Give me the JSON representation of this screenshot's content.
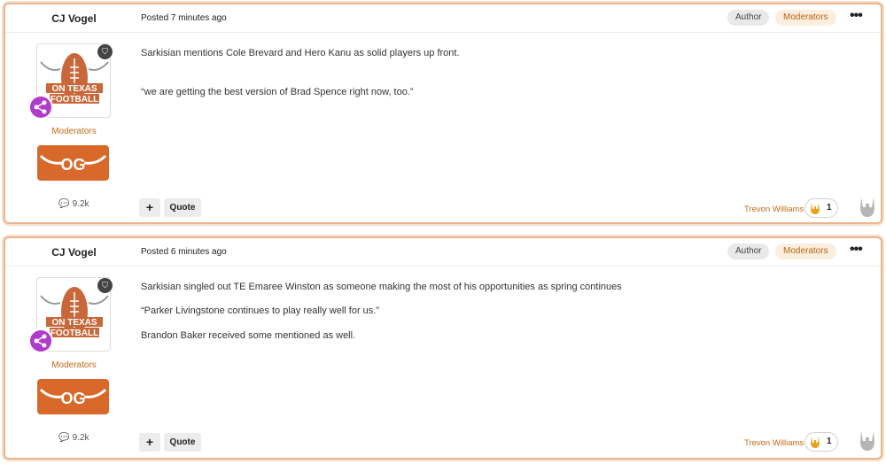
{
  "posts": [
    {
      "author": "CJ Vogel",
      "posted": "Posted 7 minutes ago",
      "badges": [
        "Author",
        "Moderators"
      ],
      "role": "Moderators",
      "reputation": "9.2k",
      "avatar_text": [
        "ON TEXAS",
        "FOOTBALL"
      ],
      "group_badge_text": "OG",
      "paragraphs": [
        "Sarkisian mentions Cole Brevard and Hero Kanu as solid players up front.",
        "“we are getting the best version of Brad Spence right now, too.”"
      ],
      "quote_label": "Quote",
      "plus_label": "+",
      "reactor": "Trevon Williams",
      "reaction_count": "1"
    },
    {
      "author": "CJ Vogel",
      "posted": "Posted 6 minutes ago",
      "badges": [
        "Author",
        "Moderators"
      ],
      "role": "Moderators",
      "reputation": "9.2k",
      "avatar_text": [
        "ON TEXAS",
        "FOOTBALL"
      ],
      "group_badge_text": "OG",
      "paragraphs": [
        "Sarkisian singled out TE Emaree Winston as someone making the most of his opportunities as spring continues",
        "“Parker Livingstone continues to play really well for us.”",
        "Brandon Baker received some mentioned as well."
      ],
      "quote_label": "Quote",
      "plus_label": "+",
      "reactor": "Trevon Williams",
      "reaction_count": "1"
    }
  ],
  "icons": {
    "menu": "ellipsis-icon",
    "moderator": "shield-icon",
    "share": "share-icon",
    "reputation": "comment-icon",
    "reaction": "horns-hand-icon"
  },
  "colors": {
    "border": "#e8b590",
    "accent": "#c76a17",
    "share_badge": "#b03cc9",
    "group_badge": "#d8692a"
  }
}
